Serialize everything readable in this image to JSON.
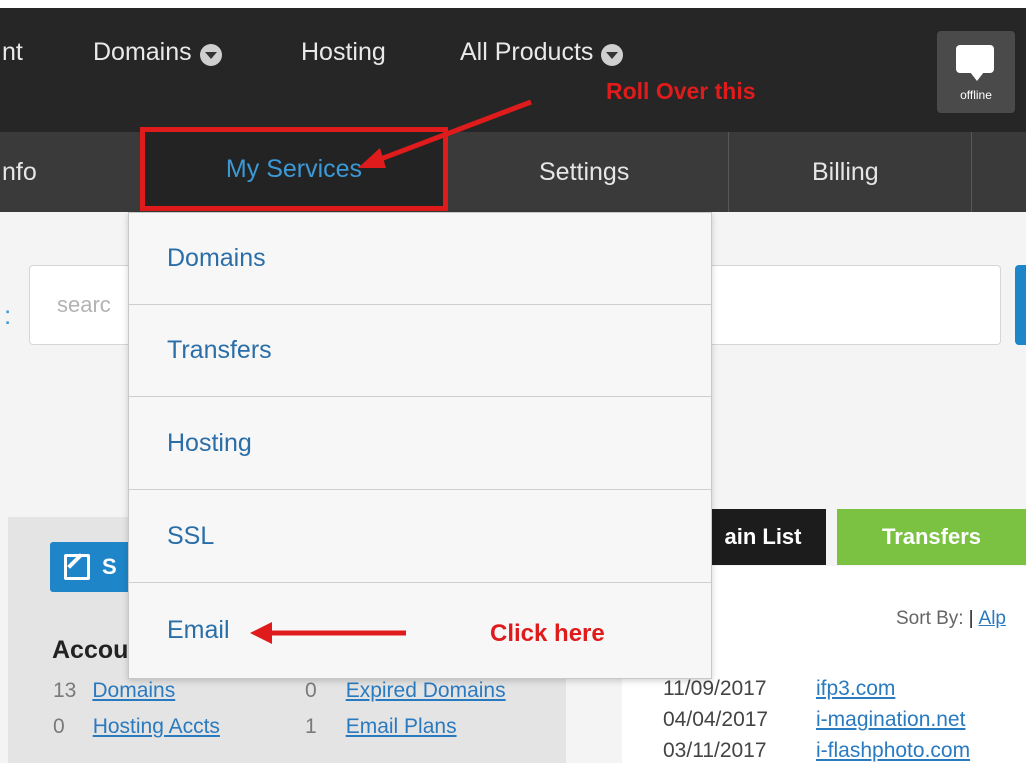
{
  "top_nav": {
    "items": [
      {
        "label": "nt"
      },
      {
        "label": "Domains",
        "has_caret": true
      },
      {
        "label": "Hosting"
      },
      {
        "label": "All Products",
        "has_caret": true
      }
    ],
    "chat": {
      "icon": "chat-bubble-icon",
      "label": "offline"
    }
  },
  "sub_nav": {
    "items": [
      {
        "label": "nfo"
      },
      {
        "label": "My Services",
        "active": true
      },
      {
        "label": "Settings"
      },
      {
        "label": "Billing"
      }
    ]
  },
  "dropdown": {
    "items": [
      "Domains",
      "Transfers",
      "Hosting",
      "SSL",
      "Email"
    ]
  },
  "search": {
    "placeholder": "searc"
  },
  "account": {
    "button_label": "S",
    "button_icon": "edit-icon",
    "heading": "Accou",
    "stats": [
      {
        "count": "13",
        "label": "Domains"
      },
      {
        "count": "0",
        "label": "Expired Domains"
      },
      {
        "count": "0",
        "label": "Hosting Accts"
      },
      {
        "count": "1",
        "label": "Email Plans"
      }
    ]
  },
  "domain_tabs": {
    "domain_list": "ain List",
    "transfers": "Transfers"
  },
  "sort": {
    "label": "Sort By:",
    "separator": "|",
    "option": "Alp"
  },
  "domains": [
    {
      "date": "11/09/2017",
      "name": "ifp3.com"
    },
    {
      "date": "04/04/2017",
      "name": "i-magination.net"
    },
    {
      "date": "03/11/2017",
      "name": "i-flashphoto.com"
    }
  ],
  "annotations": {
    "roll_over": "Roll Over this",
    "click_here": "Click here",
    "color": "#e01b1b"
  },
  "colors": {
    "top_nav_bg": "#262626",
    "sub_nav_bg": "#3a3a3a",
    "link_blue": "#2a7ac0",
    "accent_blue": "#1e86c8",
    "transfers_green": "#7cc242"
  }
}
